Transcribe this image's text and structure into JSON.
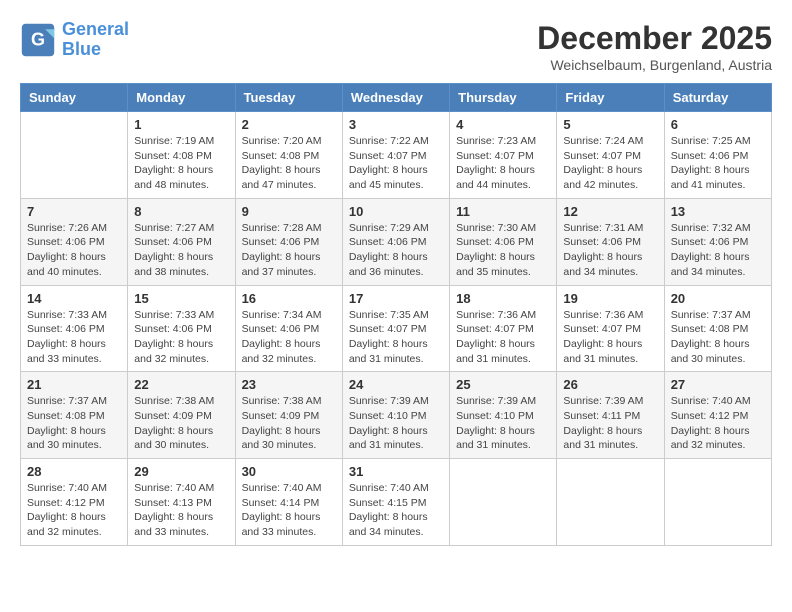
{
  "header": {
    "logo_line1": "General",
    "logo_line2": "Blue",
    "month": "December 2025",
    "location": "Weichselbaum, Burgenland, Austria"
  },
  "days_of_week": [
    "Sunday",
    "Monday",
    "Tuesday",
    "Wednesday",
    "Thursday",
    "Friday",
    "Saturday"
  ],
  "weeks": [
    [
      {
        "day": "",
        "info": ""
      },
      {
        "day": "1",
        "info": "Sunrise: 7:19 AM\nSunset: 4:08 PM\nDaylight: 8 hours\nand 48 minutes."
      },
      {
        "day": "2",
        "info": "Sunrise: 7:20 AM\nSunset: 4:08 PM\nDaylight: 8 hours\nand 47 minutes."
      },
      {
        "day": "3",
        "info": "Sunrise: 7:22 AM\nSunset: 4:07 PM\nDaylight: 8 hours\nand 45 minutes."
      },
      {
        "day": "4",
        "info": "Sunrise: 7:23 AM\nSunset: 4:07 PM\nDaylight: 8 hours\nand 44 minutes."
      },
      {
        "day": "5",
        "info": "Sunrise: 7:24 AM\nSunset: 4:07 PM\nDaylight: 8 hours\nand 42 minutes."
      },
      {
        "day": "6",
        "info": "Sunrise: 7:25 AM\nSunset: 4:06 PM\nDaylight: 8 hours\nand 41 minutes."
      }
    ],
    [
      {
        "day": "7",
        "info": "Sunrise: 7:26 AM\nSunset: 4:06 PM\nDaylight: 8 hours\nand 40 minutes."
      },
      {
        "day": "8",
        "info": "Sunrise: 7:27 AM\nSunset: 4:06 PM\nDaylight: 8 hours\nand 38 minutes."
      },
      {
        "day": "9",
        "info": "Sunrise: 7:28 AM\nSunset: 4:06 PM\nDaylight: 8 hours\nand 37 minutes."
      },
      {
        "day": "10",
        "info": "Sunrise: 7:29 AM\nSunset: 4:06 PM\nDaylight: 8 hours\nand 36 minutes."
      },
      {
        "day": "11",
        "info": "Sunrise: 7:30 AM\nSunset: 4:06 PM\nDaylight: 8 hours\nand 35 minutes."
      },
      {
        "day": "12",
        "info": "Sunrise: 7:31 AM\nSunset: 4:06 PM\nDaylight: 8 hours\nand 34 minutes."
      },
      {
        "day": "13",
        "info": "Sunrise: 7:32 AM\nSunset: 4:06 PM\nDaylight: 8 hours\nand 34 minutes."
      }
    ],
    [
      {
        "day": "14",
        "info": "Sunrise: 7:33 AM\nSunset: 4:06 PM\nDaylight: 8 hours\nand 33 minutes."
      },
      {
        "day": "15",
        "info": "Sunrise: 7:33 AM\nSunset: 4:06 PM\nDaylight: 8 hours\nand 32 minutes."
      },
      {
        "day": "16",
        "info": "Sunrise: 7:34 AM\nSunset: 4:06 PM\nDaylight: 8 hours\nand 32 minutes."
      },
      {
        "day": "17",
        "info": "Sunrise: 7:35 AM\nSunset: 4:07 PM\nDaylight: 8 hours\nand 31 minutes."
      },
      {
        "day": "18",
        "info": "Sunrise: 7:36 AM\nSunset: 4:07 PM\nDaylight: 8 hours\nand 31 minutes."
      },
      {
        "day": "19",
        "info": "Sunrise: 7:36 AM\nSunset: 4:07 PM\nDaylight: 8 hours\nand 31 minutes."
      },
      {
        "day": "20",
        "info": "Sunrise: 7:37 AM\nSunset: 4:08 PM\nDaylight: 8 hours\nand 30 minutes."
      }
    ],
    [
      {
        "day": "21",
        "info": "Sunrise: 7:37 AM\nSunset: 4:08 PM\nDaylight: 8 hours\nand 30 minutes."
      },
      {
        "day": "22",
        "info": "Sunrise: 7:38 AM\nSunset: 4:09 PM\nDaylight: 8 hours\nand 30 minutes."
      },
      {
        "day": "23",
        "info": "Sunrise: 7:38 AM\nSunset: 4:09 PM\nDaylight: 8 hours\nand 30 minutes."
      },
      {
        "day": "24",
        "info": "Sunrise: 7:39 AM\nSunset: 4:10 PM\nDaylight: 8 hours\nand 31 minutes."
      },
      {
        "day": "25",
        "info": "Sunrise: 7:39 AM\nSunset: 4:10 PM\nDaylight: 8 hours\nand 31 minutes."
      },
      {
        "day": "26",
        "info": "Sunrise: 7:39 AM\nSunset: 4:11 PM\nDaylight: 8 hours\nand 31 minutes."
      },
      {
        "day": "27",
        "info": "Sunrise: 7:40 AM\nSunset: 4:12 PM\nDaylight: 8 hours\nand 32 minutes."
      }
    ],
    [
      {
        "day": "28",
        "info": "Sunrise: 7:40 AM\nSunset: 4:12 PM\nDaylight: 8 hours\nand 32 minutes."
      },
      {
        "day": "29",
        "info": "Sunrise: 7:40 AM\nSunset: 4:13 PM\nDaylight: 8 hours\nand 33 minutes."
      },
      {
        "day": "30",
        "info": "Sunrise: 7:40 AM\nSunset: 4:14 PM\nDaylight: 8 hours\nand 33 minutes."
      },
      {
        "day": "31",
        "info": "Sunrise: 7:40 AM\nSunset: 4:15 PM\nDaylight: 8 hours\nand 34 minutes."
      },
      {
        "day": "",
        "info": ""
      },
      {
        "day": "",
        "info": ""
      },
      {
        "day": "",
        "info": ""
      }
    ]
  ]
}
